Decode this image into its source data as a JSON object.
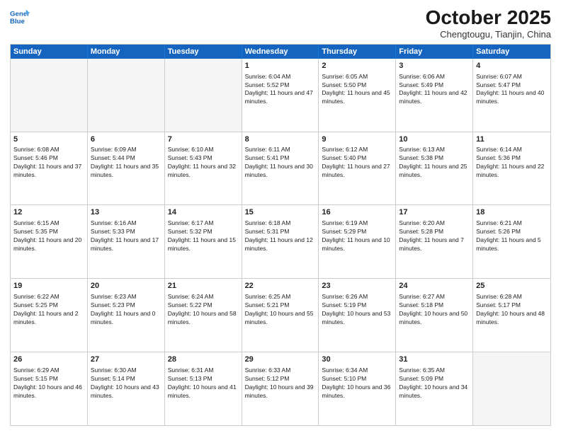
{
  "header": {
    "logo_line1": "General",
    "logo_line2": "Blue",
    "month": "October 2025",
    "location": "Chengtougu, Tianjin, China"
  },
  "days_of_week": [
    "Sunday",
    "Monday",
    "Tuesday",
    "Wednesday",
    "Thursday",
    "Friday",
    "Saturday"
  ],
  "weeks": [
    [
      {
        "day": "",
        "text": ""
      },
      {
        "day": "",
        "text": ""
      },
      {
        "day": "",
        "text": ""
      },
      {
        "day": "1",
        "text": "Sunrise: 6:04 AM\nSunset: 5:52 PM\nDaylight: 11 hours and 47 minutes."
      },
      {
        "day": "2",
        "text": "Sunrise: 6:05 AM\nSunset: 5:50 PM\nDaylight: 11 hours and 45 minutes."
      },
      {
        "day": "3",
        "text": "Sunrise: 6:06 AM\nSunset: 5:49 PM\nDaylight: 11 hours and 42 minutes."
      },
      {
        "day": "4",
        "text": "Sunrise: 6:07 AM\nSunset: 5:47 PM\nDaylight: 11 hours and 40 minutes."
      }
    ],
    [
      {
        "day": "5",
        "text": "Sunrise: 6:08 AM\nSunset: 5:46 PM\nDaylight: 11 hours and 37 minutes."
      },
      {
        "day": "6",
        "text": "Sunrise: 6:09 AM\nSunset: 5:44 PM\nDaylight: 11 hours and 35 minutes."
      },
      {
        "day": "7",
        "text": "Sunrise: 6:10 AM\nSunset: 5:43 PM\nDaylight: 11 hours and 32 minutes."
      },
      {
        "day": "8",
        "text": "Sunrise: 6:11 AM\nSunset: 5:41 PM\nDaylight: 11 hours and 30 minutes."
      },
      {
        "day": "9",
        "text": "Sunrise: 6:12 AM\nSunset: 5:40 PM\nDaylight: 11 hours and 27 minutes."
      },
      {
        "day": "10",
        "text": "Sunrise: 6:13 AM\nSunset: 5:38 PM\nDaylight: 11 hours and 25 minutes."
      },
      {
        "day": "11",
        "text": "Sunrise: 6:14 AM\nSunset: 5:36 PM\nDaylight: 11 hours and 22 minutes."
      }
    ],
    [
      {
        "day": "12",
        "text": "Sunrise: 6:15 AM\nSunset: 5:35 PM\nDaylight: 11 hours and 20 minutes."
      },
      {
        "day": "13",
        "text": "Sunrise: 6:16 AM\nSunset: 5:33 PM\nDaylight: 11 hours and 17 minutes."
      },
      {
        "day": "14",
        "text": "Sunrise: 6:17 AM\nSunset: 5:32 PM\nDaylight: 11 hours and 15 minutes."
      },
      {
        "day": "15",
        "text": "Sunrise: 6:18 AM\nSunset: 5:31 PM\nDaylight: 11 hours and 12 minutes."
      },
      {
        "day": "16",
        "text": "Sunrise: 6:19 AM\nSunset: 5:29 PM\nDaylight: 11 hours and 10 minutes."
      },
      {
        "day": "17",
        "text": "Sunrise: 6:20 AM\nSunset: 5:28 PM\nDaylight: 11 hours and 7 minutes."
      },
      {
        "day": "18",
        "text": "Sunrise: 6:21 AM\nSunset: 5:26 PM\nDaylight: 11 hours and 5 minutes."
      }
    ],
    [
      {
        "day": "19",
        "text": "Sunrise: 6:22 AM\nSunset: 5:25 PM\nDaylight: 11 hours and 2 minutes."
      },
      {
        "day": "20",
        "text": "Sunrise: 6:23 AM\nSunset: 5:23 PM\nDaylight: 11 hours and 0 minutes."
      },
      {
        "day": "21",
        "text": "Sunrise: 6:24 AM\nSunset: 5:22 PM\nDaylight: 10 hours and 58 minutes."
      },
      {
        "day": "22",
        "text": "Sunrise: 6:25 AM\nSunset: 5:21 PM\nDaylight: 10 hours and 55 minutes."
      },
      {
        "day": "23",
        "text": "Sunrise: 6:26 AM\nSunset: 5:19 PM\nDaylight: 10 hours and 53 minutes."
      },
      {
        "day": "24",
        "text": "Sunrise: 6:27 AM\nSunset: 5:18 PM\nDaylight: 10 hours and 50 minutes."
      },
      {
        "day": "25",
        "text": "Sunrise: 6:28 AM\nSunset: 5:17 PM\nDaylight: 10 hours and 48 minutes."
      }
    ],
    [
      {
        "day": "26",
        "text": "Sunrise: 6:29 AM\nSunset: 5:15 PM\nDaylight: 10 hours and 46 minutes."
      },
      {
        "day": "27",
        "text": "Sunrise: 6:30 AM\nSunset: 5:14 PM\nDaylight: 10 hours and 43 minutes."
      },
      {
        "day": "28",
        "text": "Sunrise: 6:31 AM\nSunset: 5:13 PM\nDaylight: 10 hours and 41 minutes."
      },
      {
        "day": "29",
        "text": "Sunrise: 6:33 AM\nSunset: 5:12 PM\nDaylight: 10 hours and 39 minutes."
      },
      {
        "day": "30",
        "text": "Sunrise: 6:34 AM\nSunset: 5:10 PM\nDaylight: 10 hours and 36 minutes."
      },
      {
        "day": "31",
        "text": "Sunrise: 6:35 AM\nSunset: 5:09 PM\nDaylight: 10 hours and 34 minutes."
      },
      {
        "day": "",
        "text": ""
      }
    ]
  ]
}
